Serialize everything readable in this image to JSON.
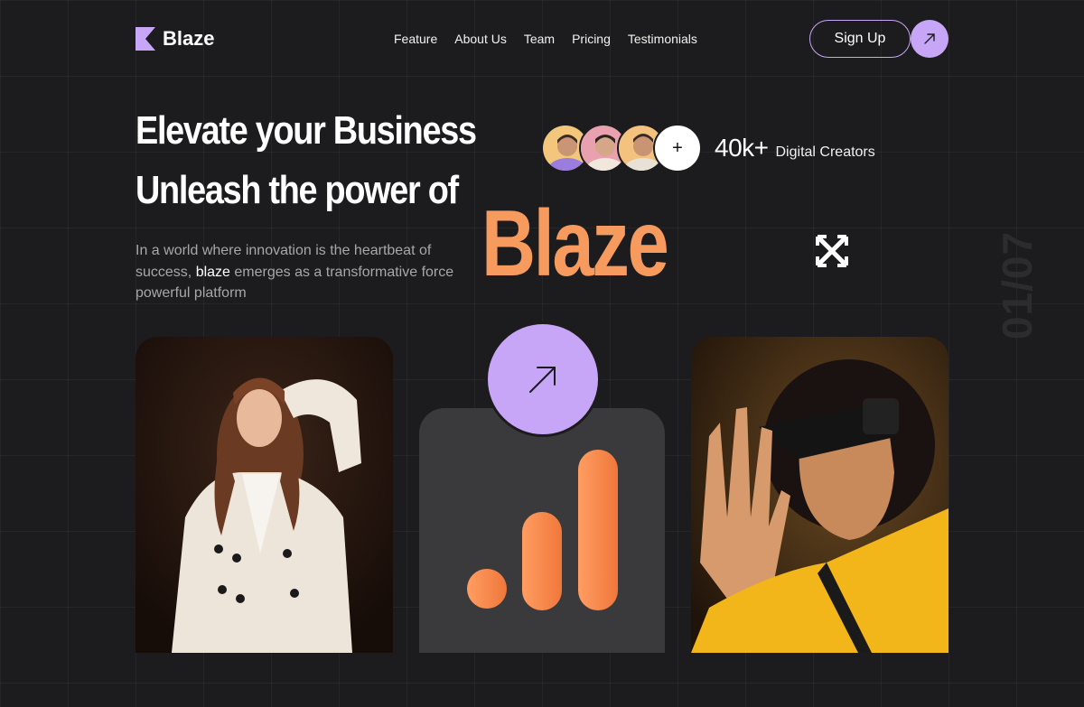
{
  "brand": {
    "name": "Blaze"
  },
  "nav": {
    "items": [
      "Feature",
      "About Us",
      "Team",
      "Pricing",
      "Testimonials"
    ]
  },
  "header": {
    "signup_label": "Sign Up"
  },
  "hero": {
    "line1": "Elevate your Business",
    "line2": "Unleash the power of",
    "brand_word": "Blaze",
    "desc_before": " In a world where innovation is the heartbeat of success, ",
    "desc_highlight": "blaze",
    "desc_after": " emerges as a transformative force powerful platform"
  },
  "creators": {
    "count": "40k+",
    "label": "Digital Creators",
    "plus": "+"
  },
  "side_counter": "01/07",
  "colors": {
    "accent_purple": "#c8a6f7",
    "accent_orange": "#f79a5e",
    "background": "#1c1c1e",
    "card": "#3a3a3c"
  },
  "icons": {
    "logo": "blaze-k-logo-icon",
    "header_arrow": "arrow-up-right-icon",
    "center_arrow": "arrow-up-right-icon",
    "cross": "cross-arrows-icon",
    "bars": "bar-chart-icon"
  }
}
